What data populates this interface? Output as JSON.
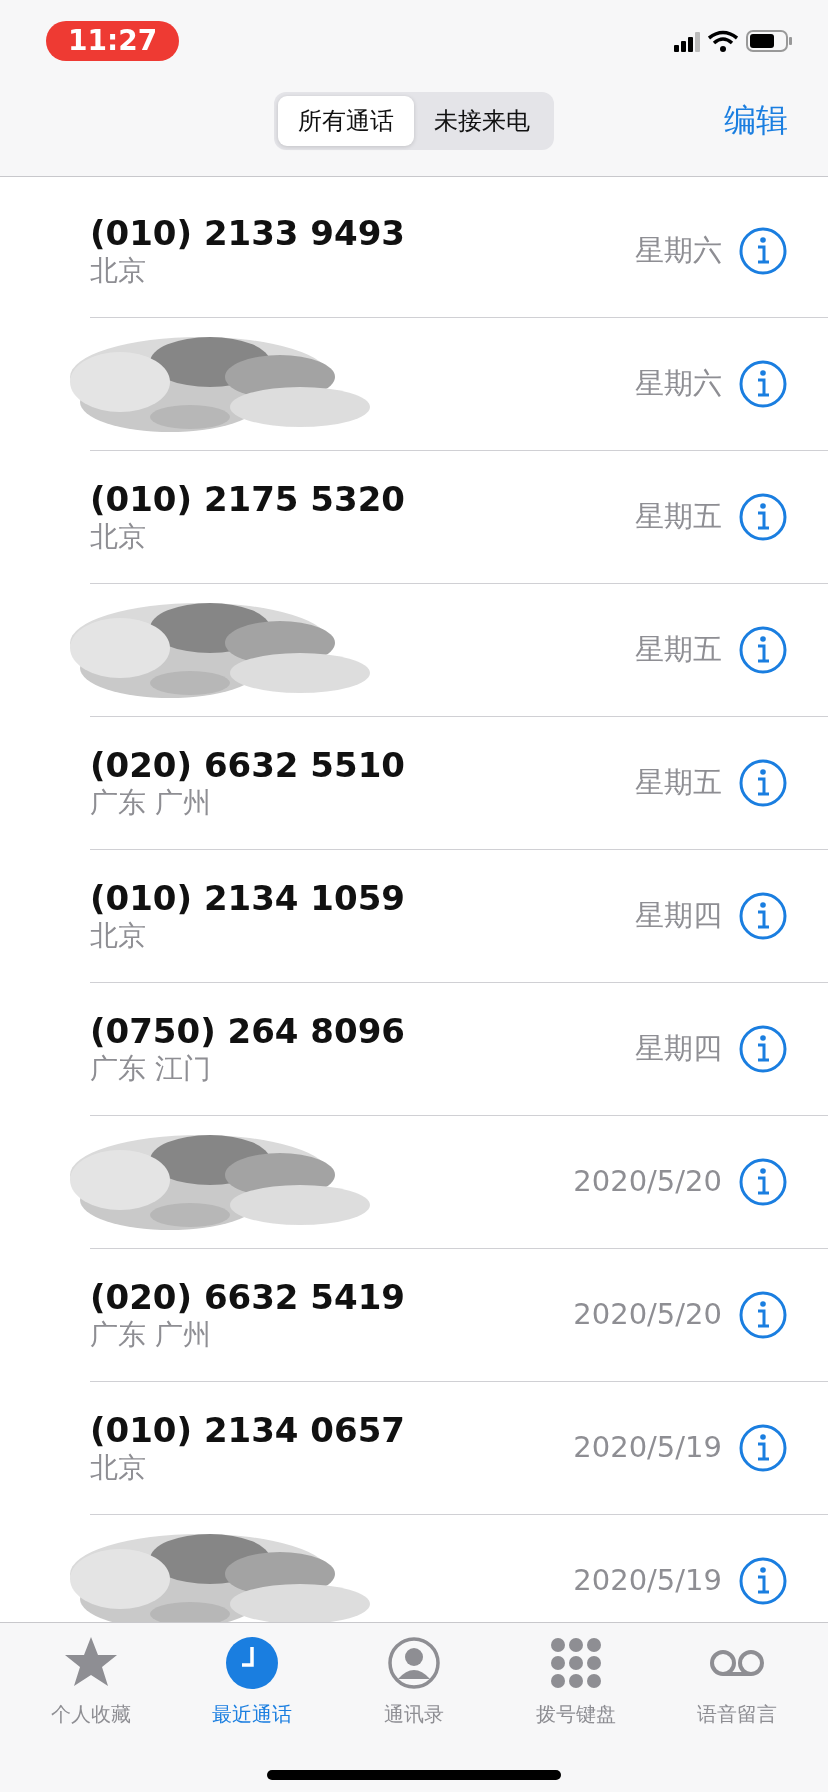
{
  "status_bar": {
    "time": "11:27"
  },
  "segments": [
    {
      "label": "所有通话",
      "selected": true
    },
    {
      "label": "未接来电",
      "selected": false
    }
  ],
  "edit_button": "编辑",
  "calls": [
    {
      "kind": "call",
      "number": "(010) 2133 9493",
      "location": "北京",
      "date": "星期六"
    },
    {
      "kind": "redacted",
      "date": "星期六"
    },
    {
      "kind": "call",
      "number": "(010) 2175 5320",
      "location": "北京",
      "date": "星期五"
    },
    {
      "kind": "redacted",
      "date": "星期五"
    },
    {
      "kind": "call",
      "number": "(020) 6632 5510",
      "location": "广东 广州",
      "date": "星期五"
    },
    {
      "kind": "call",
      "number": "(010) 2134 1059",
      "location": "北京",
      "date": "星期四"
    },
    {
      "kind": "call",
      "number": "(0750) 264 8096",
      "location": "广东 江门",
      "date": "星期四"
    },
    {
      "kind": "redacted",
      "date": "2020/5/20"
    },
    {
      "kind": "call",
      "number": "(020) 6632 5419",
      "location": "广东 广州",
      "date": "2020/5/20"
    },
    {
      "kind": "call",
      "number": "(010) 2134 0657",
      "location": "北京",
      "date": "2020/5/19"
    },
    {
      "kind": "redacted",
      "date": "2020/5/19"
    }
  ],
  "tab_bar": [
    {
      "kind": "star",
      "label": "个人收藏",
      "selected": false
    },
    {
      "kind": "clock",
      "label": "最近通话",
      "selected": true
    },
    {
      "kind": "person",
      "label": "通讯录",
      "selected": false
    },
    {
      "kind": "keypad",
      "label": "拨号键盘",
      "selected": false
    },
    {
      "kind": "voicemail",
      "label": "语音留言",
      "selected": false
    }
  ]
}
